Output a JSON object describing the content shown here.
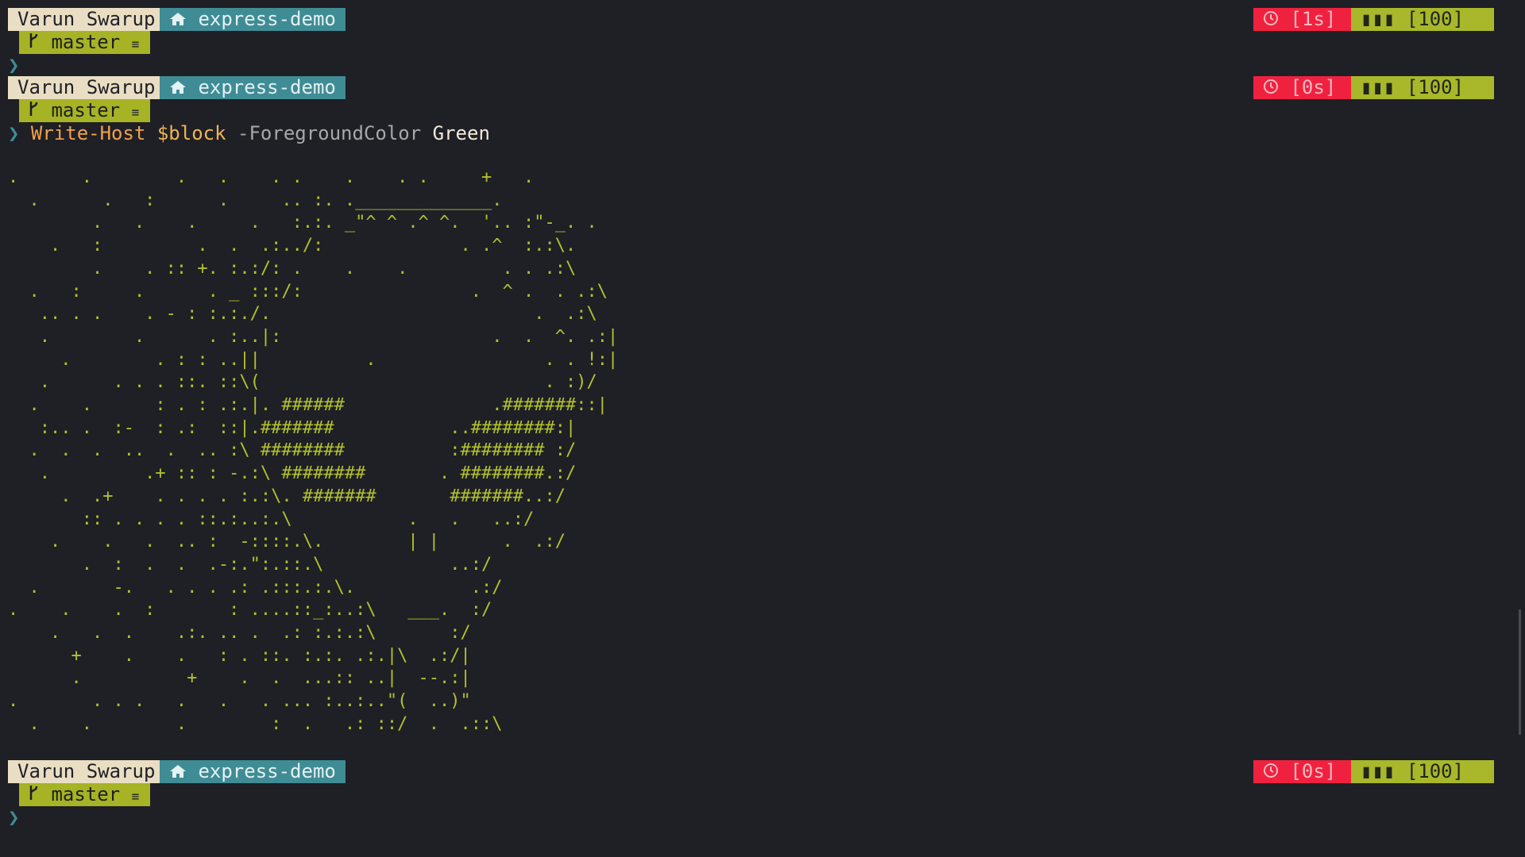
{
  "prompts": [
    {
      "user": "Varun Swarup",
      "dir": "express-demo",
      "branch": "master",
      "branch_status": "≡",
      "time": "[1s]",
      "battery": "[100]",
      "battery_bars": "▮▮▮"
    },
    {
      "user": "Varun Swarup",
      "dir": "express-demo",
      "branch": "master",
      "branch_status": "≡",
      "time": "[0s]",
      "battery": "[100]",
      "battery_bars": "▮▮▮"
    },
    {
      "user": "Varun Swarup",
      "dir": "express-demo",
      "branch": "master",
      "branch_status": "≡",
      "time": "[0s]",
      "battery": "[100]",
      "battery_bars": "▮▮▮"
    }
  ],
  "prompt_chevron": "❯",
  "command": {
    "name": "Write-Host",
    "variable": "$block",
    "parameter": "-ForegroundColor",
    "argument": "Green"
  },
  "ascii_art": ".      .        .   .    . .    .    . .     +   .\n  .      .   :      .     .. :. ._____________.\n        .   .    .     .   :.:. _\"^ ^ .^ ^.  '.. :\"-_. .\n    .   :         .  .  .:../:             . .^  :.:\\.\n        .    . :: +. :.:/: .    .    .         . . .:\\\n  .   :     .      . _ :::/:                .  ^ .  . .:\\\n   .. . .    . - : :.:./.                         .  .:\\\n   .        .      . :..|:                    .  .  ^. .:|\n     .        . : : ..||          .                . . !:|\n   .      . . . ::. ::\\(                           . :)/\n  .    .      : . : .:.|. ######              .#######::|\n   :.. .  :-  : .:  ::|.#######           ..########:|\n  .  .  .  ..  .  .. :\\ ########          :######## :/\n   .         .+ :: : -.:\\ ########       . ########.:/\n     .  .+    . . . . :.:\\. #######       #######..:/\n       :: . . . . ::.:..:.\\           .   .   ..:/\n    .    .   .  .. :  -::::.\\.        | |      .  .:/\n       .  :  .  .  .-:.\":.::.\\            ..:/\n  .       -.   . . . .: .:::.:.\\.           .:/\n.    .    .  :       : ....::_:..:\\   ___.  :/\n    .   .  .    .:. .. .  .: :.:.:\\       :/\n      +    .    .   : . ::. :.:. .:.|\\  .:/|\n      .          +    .  .  ...:: ..|  --.:|\n.       . . .   .   .   . ... :..:..\"(  ..)\"\n  .    .        .        :  .   .: ::/  .  .::\\"
}
